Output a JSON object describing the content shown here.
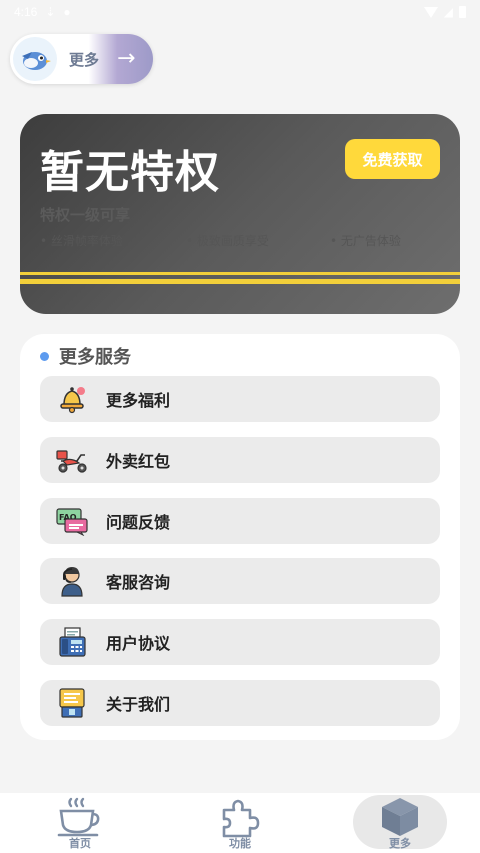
{
  "status_bar": {
    "time": "4:16"
  },
  "top_pill": {
    "label": "更多",
    "arrow": "→"
  },
  "privilege_card": {
    "title": "暂无特权",
    "button_label": "免费获取",
    "subtitle": "特权一级可享",
    "features": [
      "丝滑帧率体验",
      "极致画质享受",
      "无广告体验"
    ]
  },
  "services": {
    "title": "更多服务",
    "items": [
      {
        "label": "更多福利",
        "icon": "bell-icon"
      },
      {
        "label": "外卖红包",
        "icon": "scooter-icon"
      },
      {
        "label": "问题反馈",
        "icon": "faq-icon"
      },
      {
        "label": "客服咨询",
        "icon": "customer-service-icon"
      },
      {
        "label": "用户协议",
        "icon": "fax-icon"
      },
      {
        "label": "关于我们",
        "icon": "about-icon"
      }
    ]
  },
  "bottom_nav": {
    "items": [
      {
        "label": "首页",
        "icon": "coffee-cup-icon"
      },
      {
        "label": "功能",
        "icon": "puzzle-icon"
      },
      {
        "label": "更多",
        "icon": "cube-icon"
      }
    ],
    "active_index": 2
  }
}
